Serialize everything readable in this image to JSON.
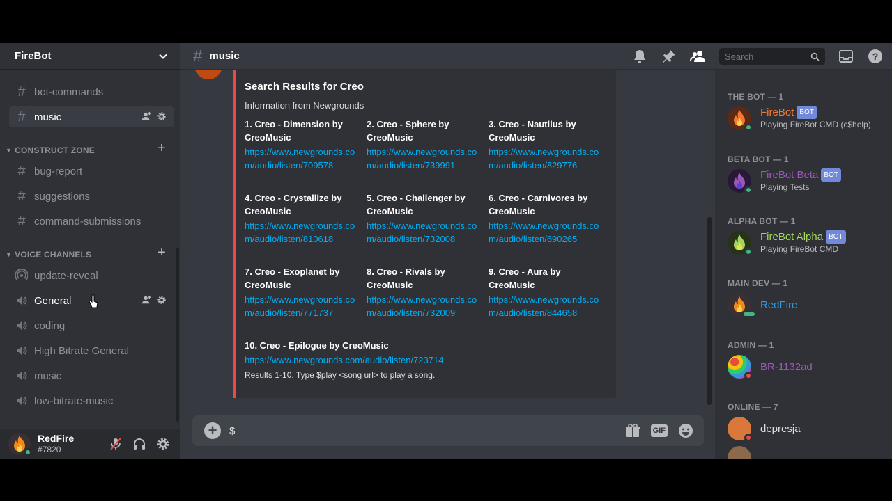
{
  "server": {
    "name": "FireBot"
  },
  "channels": {
    "text": [
      {
        "name": "bot-commands"
      },
      {
        "name": "music"
      }
    ],
    "categories": [
      {
        "name": "CONSTRUCT ZONE",
        "channels": [
          "bug-report",
          "suggestions",
          "command-submissions"
        ]
      },
      {
        "name": "VOICE CHANNELS",
        "channels": [
          "update-reveal",
          "General",
          "coding",
          "High Bitrate General",
          "music",
          "low-bitrate-music"
        ]
      }
    ]
  },
  "user_panel": {
    "name": "RedFire",
    "tag": "#7820"
  },
  "header": {
    "channel": "music",
    "search_placeholder": "Search"
  },
  "embed": {
    "title": "Search Results for Creo",
    "description": "Information from Newgrounds",
    "fields": [
      {
        "name": "1. Creo - Dimension by CreoMusic",
        "link": "https://www.newgrounds.com/audio/listen/709578"
      },
      {
        "name": "2. Creo - Sphere by CreoMusic",
        "link": "https://www.newgrounds.com/audio/listen/739991"
      },
      {
        "name": "3. Creo - Nautilus by CreoMusic",
        "link": "https://www.newgrounds.com/audio/listen/829776"
      },
      {
        "name": "4. Creo - Crystallize by CreoMusic",
        "link": "https://www.newgrounds.com/audio/listen/810618"
      },
      {
        "name": "5. Creo - Challenger by CreoMusic",
        "link": "https://www.newgrounds.com/audio/listen/732008"
      },
      {
        "name": "6. Creo - Carnivores by CreoMusic",
        "link": "https://www.newgrounds.com/audio/listen/690265"
      },
      {
        "name": "7. Creo - Exoplanet by CreoMusic",
        "link": "https://www.newgrounds.com/audio/listen/771737"
      },
      {
        "name": "8. Creo - Rivals by CreoMusic",
        "link": "https://www.newgrounds.com/audio/listen/732009"
      },
      {
        "name": "9. Creo - Aura by CreoMusic",
        "link": "https://www.newgrounds.com/audio/listen/844658"
      },
      {
        "name": "10. Creo - Epilogue by CreoMusic",
        "link": "https://www.newgrounds.com/audio/listen/723714"
      }
    ],
    "footer": "Results 1-10. Type $play <song url> to play a song.",
    "accent_color": "#f04747"
  },
  "composer": {
    "value": "$",
    "gif_label": "GIF"
  },
  "members": {
    "groups": [
      {
        "label": "THE BOT — 1",
        "members": [
          {
            "name": "FireBot",
            "bot": "BOT",
            "activity": "Playing FireBot CMD (c$help)",
            "color": "#f57731"
          }
        ]
      },
      {
        "label": "BETA BOT — 1",
        "members": [
          {
            "name": "FireBot Beta",
            "bot": "BOT",
            "activity": "Playing Tests",
            "color": "#9b59b6"
          }
        ]
      },
      {
        "label": "ALPHA BOT — 1",
        "members": [
          {
            "name": "FireBot Alpha",
            "bot": "BOT",
            "activity": "Playing FireBot CMD",
            "color": "#a4d65e"
          }
        ]
      },
      {
        "label": "MAIN DEV — 1",
        "members": [
          {
            "name": "RedFire",
            "activity": "",
            "color": "#3498db"
          }
        ]
      },
      {
        "label": "ADMIN — 1",
        "members": [
          {
            "name": "BR-1132ad",
            "activity": "",
            "color": "#9b59b6"
          }
        ]
      },
      {
        "label": "ONLINE — 7",
        "members": [
          {
            "name": "depresja",
            "activity": "",
            "color": "#dcddde"
          }
        ]
      }
    ]
  },
  "colors": {
    "background": "#36393f",
    "sidebar": "#2f3136",
    "link": "#00aff4",
    "online": "#43b581",
    "dnd": "#f04747"
  }
}
